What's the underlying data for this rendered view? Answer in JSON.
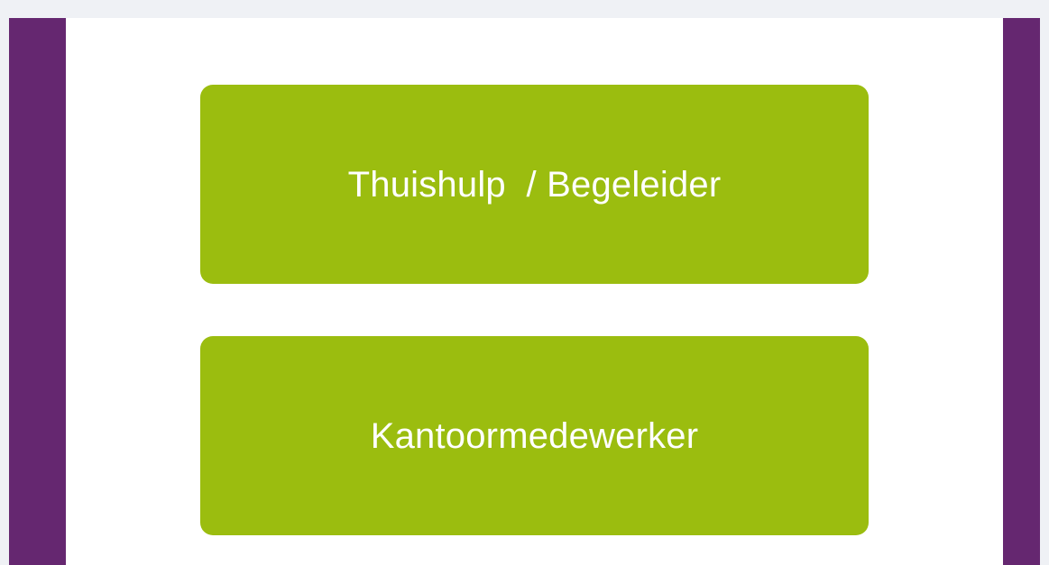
{
  "buttons": [
    {
      "label": "Thuishulp  / Begeleider"
    },
    {
      "label": "Kantoormedewerker"
    }
  ],
  "colors": {
    "page_background": "#eff1f5",
    "frame": "#652770",
    "content_background": "#ffffff",
    "button_background": "#9bbd0f",
    "button_text": "#ffffff"
  }
}
